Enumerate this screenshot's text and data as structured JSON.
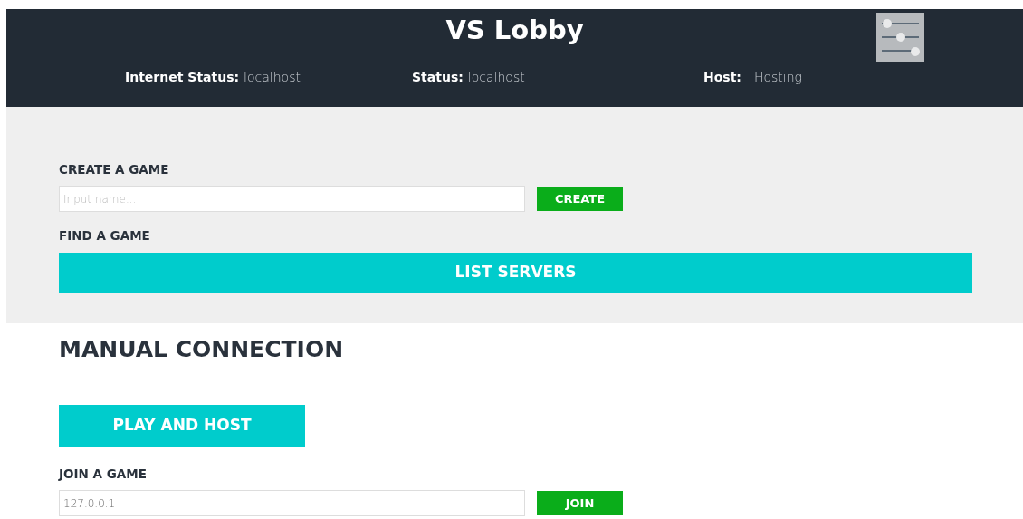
{
  "header": {
    "title": "VS Lobby",
    "statuses": [
      {
        "label": "Internet Status:",
        "value": "localhost"
      },
      {
        "label": "Status:",
        "value": "localhost"
      },
      {
        "label": "Host:",
        "value": "Hosting"
      }
    ]
  },
  "create": {
    "heading": "CREATE A GAME",
    "placeholder": "Input name...",
    "button": "CREATE"
  },
  "find": {
    "heading": "FIND A GAME",
    "button": "LIST SERVERS"
  },
  "manual": {
    "heading": "MANUAL CONNECTION",
    "host_button": "PLAY AND HOST",
    "join_heading": "JOIN A GAME",
    "value": "127.0.0.1",
    "button": "JOIN"
  }
}
